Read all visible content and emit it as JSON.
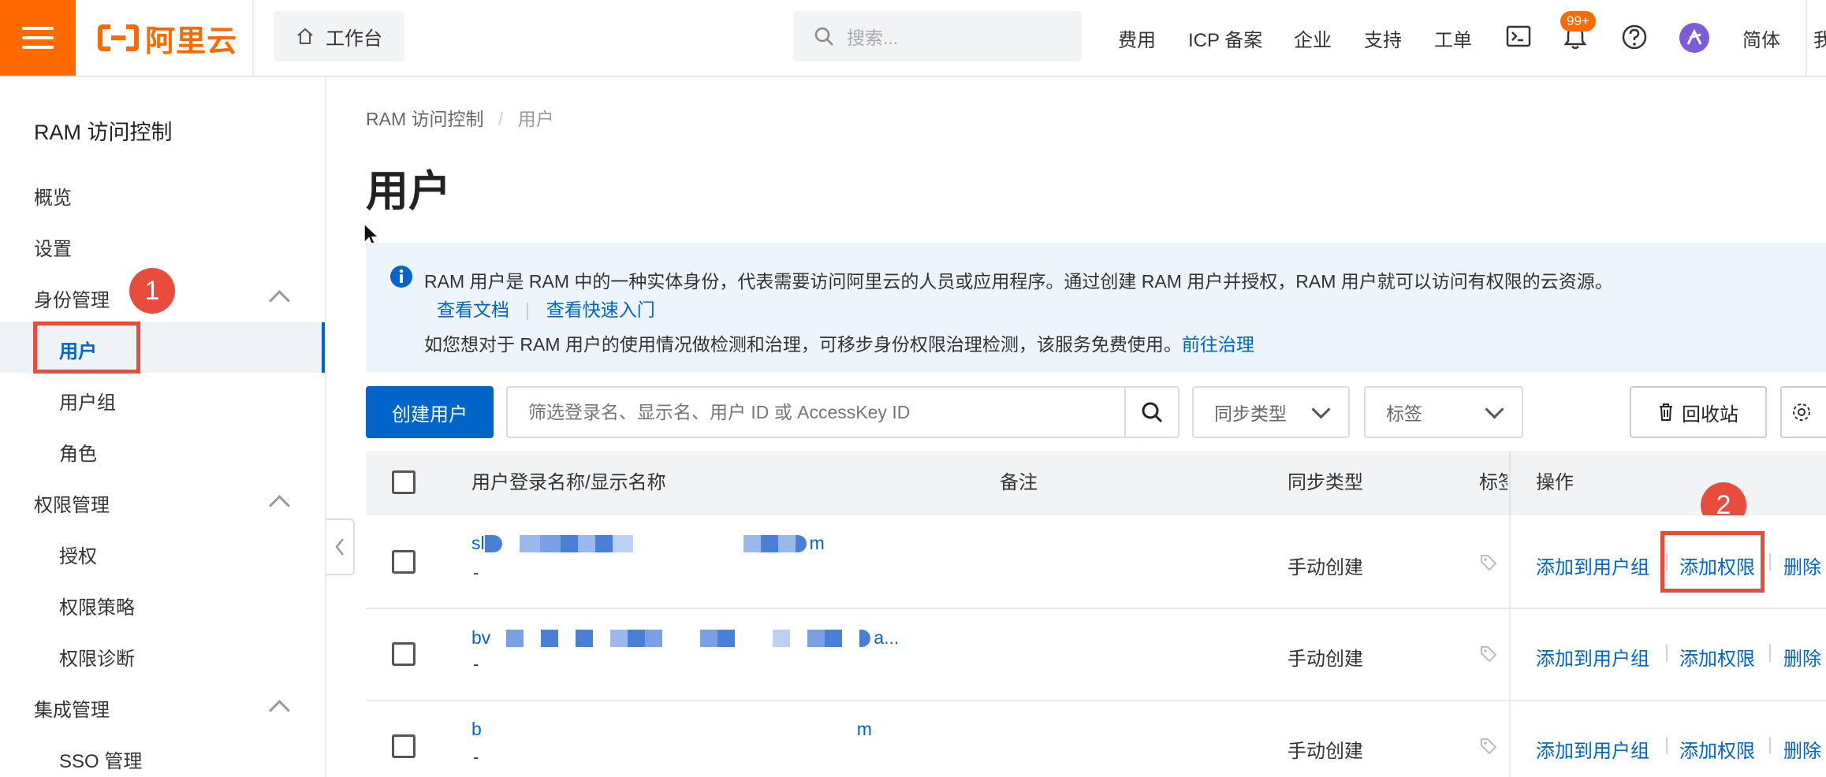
{
  "topbar": {
    "brand": "阿里云",
    "workbench": "工作台",
    "search_placeholder": "搜索...",
    "nav": [
      "费用",
      "ICP 备案",
      "企业",
      "支持",
      "工单"
    ],
    "notification_count": "99+",
    "language": "简体",
    "account_initial": "我"
  },
  "sidebar": {
    "title": "RAM 访问控制",
    "items": {
      "overview": "概览",
      "settings": "设置",
      "identity": "身份管理",
      "users": "用户",
      "groups": "用户组",
      "roles": "角色",
      "permissions": "权限管理",
      "grants": "授权",
      "policies": "权限策略",
      "diagnosis": "权限诊断",
      "integration": "集成管理",
      "sso": "SSO 管理"
    }
  },
  "annotations": {
    "step1": "1",
    "step2": "2"
  },
  "breadcrumb": {
    "root": "RAM 访问控制",
    "sep": "/",
    "current": "用户"
  },
  "page_title": "用户",
  "info": {
    "line1": "RAM 用户是 RAM 中的一种实体身份，代表需要访问阿里云的人员或应用程序。通过创建 RAM 用户并授权，RAM 用户就可以访问有权限的云资源。",
    "link_docs": "查看文档",
    "link_quickstart": "查看快速入门",
    "line3": "如您想对于 RAM 用户的使用情况做检测和治理，可移步身份权限治理检测，该服务免费使用。",
    "link_governance": "前往治理"
  },
  "toolbar": {
    "create_user": "创建用户",
    "filter_placeholder": "筛选登录名、显示名、用户 ID 或 AccessKey ID",
    "sync_type": "同步类型",
    "tag": "标签",
    "recycle_bin": "回收站"
  },
  "table": {
    "headers": {
      "name": "用户登录名称/显示名称",
      "remark": "备注",
      "sync": "同步类型",
      "tag": "标签",
      "ops": "操作"
    },
    "rows": [
      {
        "name_start": "sl",
        "name_end": "m",
        "display": "-",
        "sync": "手动创建",
        "op_group": "添加到用户组",
        "op_perm": "添加权限",
        "op_delete": "删除"
      },
      {
        "name_start": "bv",
        "name_end": "a...",
        "display": "-",
        "sync": "手动创建",
        "op_group": "添加到用户组",
        "op_perm": "添加权限",
        "op_delete": "删除"
      },
      {
        "name_start": "b",
        "name_end": "m",
        "display": "-",
        "sync": "手动创建",
        "op_group": "添加到用户组",
        "op_perm": "添加权限",
        "op_delete": "删除"
      }
    ]
  },
  "colors": {
    "brand": "#ff6a00",
    "primary": "#0064c8",
    "highlight": "#e84c3d",
    "info_bg": "#eef4fb"
  }
}
